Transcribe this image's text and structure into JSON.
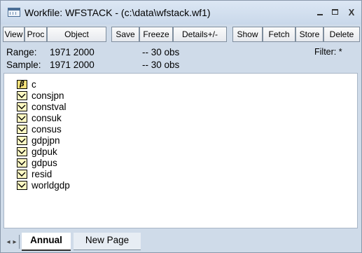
{
  "window": {
    "title": "Workfile: WFSTACK - (c:\\data\\wfstack.wf1)",
    "controls": {
      "minimize": "–",
      "maximize": "□",
      "close": "X"
    }
  },
  "toolbar": {
    "buttons": [
      "View",
      "Proc",
      "Object",
      "Save",
      "Freeze",
      "Details+/-",
      "Show",
      "Fetch",
      "Store",
      "Delete"
    ]
  },
  "info": {
    "range_label": "Range:",
    "range_value": "1971 2000",
    "range_obs": "--   30 obs",
    "sample_label": "Sample:",
    "sample_value": "1971 2000",
    "sample_obs": "--   30 obs",
    "filter": "Filter: *"
  },
  "objects": [
    {
      "name": "c",
      "icon": "coefficient-vector-icon",
      "icon_text": "β"
    },
    {
      "name": "consjpn",
      "icon": "series-icon"
    },
    {
      "name": "constval",
      "icon": "series-icon"
    },
    {
      "name": "consuk",
      "icon": "series-icon"
    },
    {
      "name": "consus",
      "icon": "series-icon"
    },
    {
      "name": "gdpjpn",
      "icon": "series-icon"
    },
    {
      "name": "gdpuk",
      "icon": "series-icon"
    },
    {
      "name": "gdpus",
      "icon": "series-icon"
    },
    {
      "name": "resid",
      "icon": "series-icon"
    },
    {
      "name": "worldgdp",
      "icon": "series-icon"
    }
  ],
  "tabs": {
    "nav_left": "◂",
    "nav_right": "▸",
    "items": [
      {
        "label": "Annual",
        "active": true
      },
      {
        "label": "New Page",
        "active": false
      }
    ]
  },
  "colors": {
    "window_bg": "#cfdbe9",
    "series_icon_fill": "#fff9c2",
    "coef_icon_fill": "#f6e17a"
  }
}
